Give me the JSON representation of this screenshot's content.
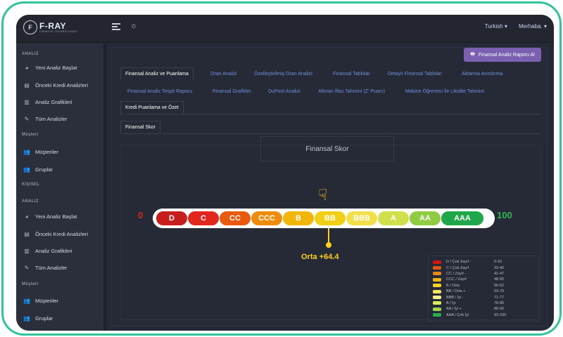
{
  "app": {
    "logo_main": "F-RAY",
    "logo_sub": "FINANCIAL TECHNOLOGIES",
    "logo_mark": "F"
  },
  "topbar": {
    "language": "Turkish ▾",
    "greeting": "Merhaba. ▾"
  },
  "sidebar": {
    "sections": [
      {
        "title": "ANALIZ",
        "items": [
          "Yeni Analiz Başlat",
          "Önceki Kredi Analizleri",
          "Analiz Grafikleri",
          "Tüm Analizler"
        ]
      },
      {
        "title": "Müşteri",
        "items": [
          "Müşteriler",
          "Gruplar"
        ]
      },
      {
        "title": "KIŞISEL",
        "items": []
      },
      {
        "title": "ANALIZ",
        "items": [
          "Yeni Analiz Başlat",
          "Önceki Kredi Analizleri",
          "Analiz Grafikleri",
          "Tüm Analizler"
        ]
      },
      {
        "title": "Müşteri",
        "items": [
          "Müşteriler",
          "Gruplar"
        ]
      }
    ]
  },
  "main": {
    "report_button": "Finansal Analiz Raporu Al",
    "tabs_row1": [
      "Finansal Analiz ve Puanlama",
      "Oran Analizi",
      "Özelleştirilmiş Oran Analizi",
      "Finansal Tablolar",
      "Detaylı Finansal Tablolar",
      "Aktarma Arındırma"
    ],
    "tabs_row2": [
      "Finansal Analiz Tespit Raporu",
      "Finansal Grafikler",
      "DuPont Analizi",
      "Altman İflas Tahmini (Z' Puanı)",
      "Makine Öğrenimi İle Likidite Tahmini"
    ],
    "tabs_row3": [
      "Kredi Puanlama ve Özet"
    ],
    "subtab": "Finansal Skor",
    "score_title": "Finansal Skor",
    "scale_min": "0",
    "scale_max": "100",
    "score_label": "Orta +64.4",
    "score_value": 64.4,
    "grades": [
      {
        "label": "D",
        "color": "#c81d1d"
      },
      {
        "label": "C",
        "color": "#e2261e"
      },
      {
        "label": "CC",
        "color": "#ea5a0e"
      },
      {
        "label": "CCC",
        "color": "#f08c0c"
      },
      {
        "label": "B",
        "color": "#f2b50a"
      },
      {
        "label": "BB",
        "color": "#f3cf13"
      },
      {
        "label": "BBB",
        "color": "#f2df4a"
      },
      {
        "label": "A",
        "color": "#cfe04a"
      },
      {
        "label": "AA",
        "color": "#8fcc42"
      },
      {
        "label": "AAA",
        "color": "#1fa84a"
      }
    ],
    "legend": [
      {
        "name": "D / Çok Zayıf -",
        "range": "0-32",
        "color": "#d41414"
      },
      {
        "name": "C / Çok Zayıf",
        "range": "33-40",
        "color": "#e05512"
      },
      {
        "name": "CC / Zayıf -",
        "range": "41-47",
        "color": "#e48a14"
      },
      {
        "name": "CCC / Zayıf",
        "range": "48-55",
        "color": "#f0b414"
      },
      {
        "name": "B / Orta",
        "range": "56-62",
        "color": "#f5d31e"
      },
      {
        "name": "BB / Orta +",
        "range": "63-70",
        "color": "#f7e45a"
      },
      {
        "name": "BBB / İyi -",
        "range": "71-77",
        "color": "#f3ee8a"
      },
      {
        "name": "A / İyi",
        "range": "78-85",
        "color": "#d9ea5a"
      },
      {
        "name": "AA / İyi +",
        "range": "86-92",
        "color": "#9fd64c"
      },
      {
        "name": "AAA / Çok İyi",
        "range": "93-100",
        "color": "#24b04a"
      }
    ]
  }
}
